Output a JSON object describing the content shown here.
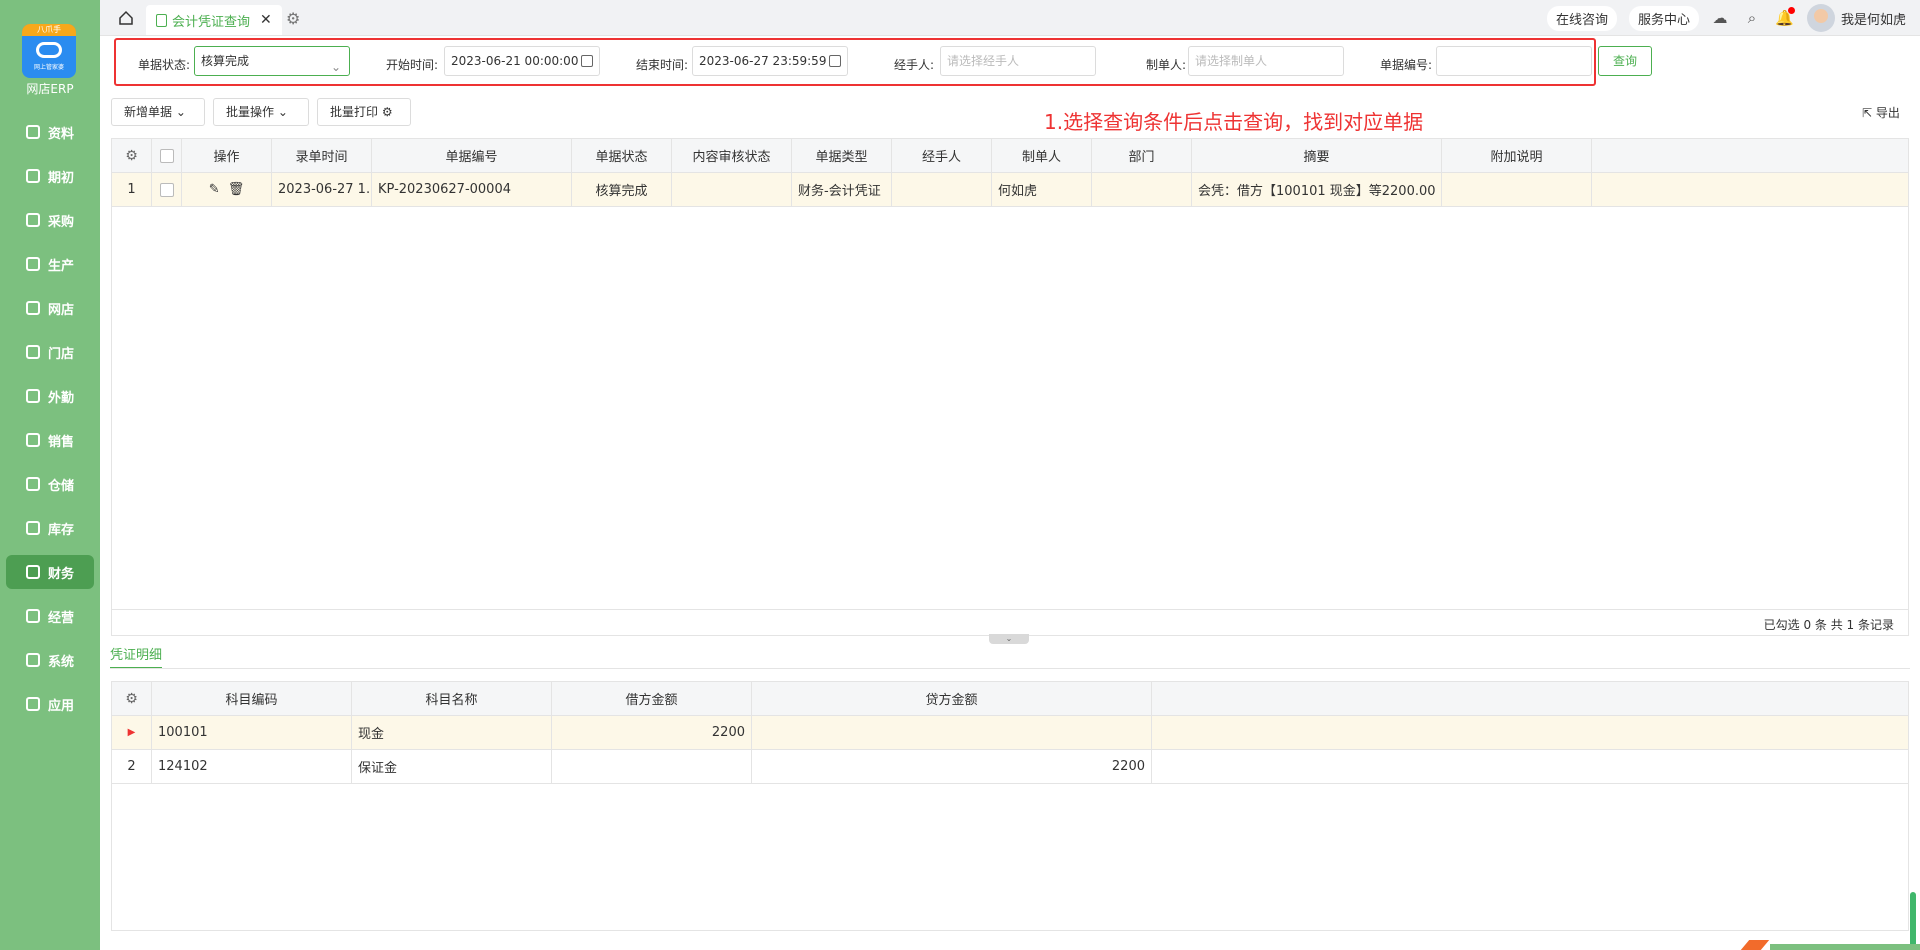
{
  "app": {
    "logo_badge": "八爪手",
    "logo_sub": "网上管家婆",
    "name": "网店ERP"
  },
  "sidebar": {
    "items": [
      {
        "label": "资料",
        "icon": "data-icon"
      },
      {
        "label": "期初",
        "icon": "initial-icon"
      },
      {
        "label": "采购",
        "icon": "purchase-icon"
      },
      {
        "label": "生产",
        "icon": "production-icon"
      },
      {
        "label": "网店",
        "icon": "shop-icon"
      },
      {
        "label": "门店",
        "icon": "store-icon"
      },
      {
        "label": "外勤",
        "icon": "field-icon"
      },
      {
        "label": "销售",
        "icon": "sales-icon"
      },
      {
        "label": "仓储",
        "icon": "warehouse-icon"
      },
      {
        "label": "库存",
        "icon": "inventory-icon"
      },
      {
        "label": "财务",
        "icon": "finance-icon",
        "active": true
      },
      {
        "label": "经营",
        "icon": "business-icon"
      },
      {
        "label": "系统",
        "icon": "system-icon"
      },
      {
        "label": "应用",
        "icon": "apps-icon"
      }
    ]
  },
  "topbar": {
    "tab_label": "会计凭证查询",
    "consult": "在线咨询",
    "service": "服务中心",
    "user": "我是何如虎"
  },
  "filter": {
    "status_label": "单据状态:",
    "status_value": "核算完成",
    "start_label": "开始时间:",
    "start_value": "2023-06-21 00:00:00",
    "end_label": "结束时间:",
    "end_value": "2023-06-27 23:59:59",
    "handler_label": "经手人:",
    "handler_placeholder": "请选择经手人",
    "maker_label": "制单人:",
    "maker_placeholder": "请选择制单人",
    "number_label": "单据编号:",
    "number_value": "",
    "query": "查询"
  },
  "toolbar": {
    "new": "新增单据",
    "batch": "批量操作",
    "print": "批量打印",
    "export": "导出"
  },
  "annotation": "1.选择查询条件后点击查询，找到对应单据",
  "grid": {
    "headers": [
      "操作",
      "录单时间",
      "单据编号",
      "单据状态",
      "内容审核状态",
      "单据类型",
      "经手人",
      "制单人",
      "部门",
      "摘要",
      "附加说明"
    ],
    "rows": [
      {
        "idx": "1",
        "time": "2023-06-27 1...",
        "number": "KP-20230627-00004",
        "status": "核算完成",
        "audit": "",
        "type": "财务-会计凭证",
        "handler": "",
        "maker": "何如虎",
        "dept": "",
        "summary": "会凭：借方【100101 现金】等2200.00",
        "note": ""
      }
    ],
    "summary": "已勾选 0 条  共 1 条记录"
  },
  "detail": {
    "tab": "凭证明细",
    "headers": [
      "科目编码",
      "科目名称",
      "借方金额",
      "贷方金额"
    ],
    "rows": [
      {
        "idx": "",
        "code": "100101",
        "name": "现金",
        "debit": "2200",
        "credit": ""
      },
      {
        "idx": "2",
        "code": "124102",
        "name": "保证金",
        "debit": "",
        "credit": "2200"
      }
    ]
  }
}
